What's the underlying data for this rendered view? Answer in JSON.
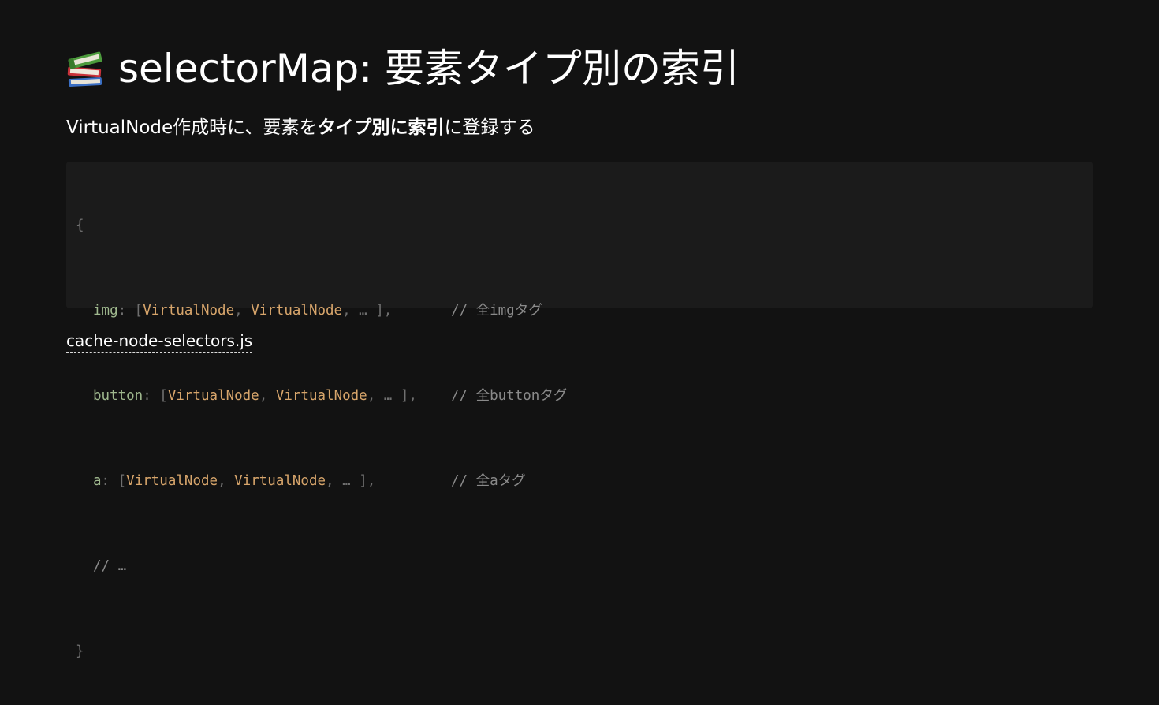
{
  "title": {
    "icon": "books-icon",
    "text": "selectorMap: 要素タイプ別の索引"
  },
  "subtitle": {
    "part1": "VirtualNode作成時に、要素を",
    "bold": "タイプ別に索引",
    "part2": "に登録する"
  },
  "code": {
    "open_brace": "{",
    "close_brace": "}",
    "lines": [
      {
        "key": "img",
        "colon": ": [",
        "type1": "VirtualNode",
        "sep": ", ",
        "type2": "VirtualNode",
        "rest": ", … ],",
        "comment": "// 全imgタグ"
      },
      {
        "key": "button",
        "colon": ": [",
        "type1": "VirtualNode",
        "sep": ", ",
        "type2": "VirtualNode",
        "rest": ", … ],",
        "comment": "// 全buttonタグ"
      },
      {
        "key": "a",
        "colon": ": [",
        "type1": "VirtualNode",
        "sep": ", ",
        "type2": "VirtualNode",
        "rest": ", … ],",
        "comment": "// 全aタグ"
      }
    ],
    "ellipsis_comment": "// …"
  },
  "file_link": "cache-node-selectors.js",
  "colors": {
    "background": "#121212",
    "code_background": "#1b1b1b",
    "key": "#9fb88e",
    "type": "#d7a56b",
    "punct": "#6f6f6f",
    "comment": "#8a8a8a"
  }
}
